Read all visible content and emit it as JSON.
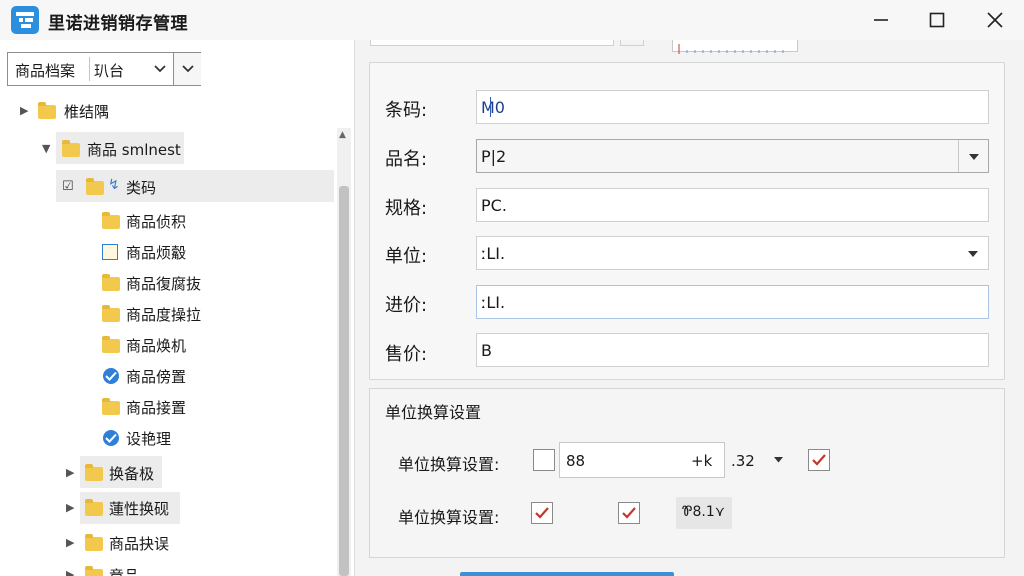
{
  "window": {
    "title": "里诺进销销存管理",
    "colors": {
      "accent": "#2b8fe0",
      "check_red": "#c0392b",
      "check_blue": "#2f7fd6",
      "folder": "#f2c94c"
    }
  },
  "sidebar": {
    "combo": {
      "text1": "商品档案",
      "text2": "玐台"
    },
    "tree": [
      {
        "label": "椎结隅",
        "icon": "folder-icon",
        "expander": "collapsed"
      },
      {
        "label": "商品 smlnest",
        "icon": "folder-icon",
        "expander": "expanded"
      },
      {
        "label": "类码",
        "icon": "folder-icon",
        "expander": "expanded"
      },
      {
        "label": "商品侦积",
        "icon": "folder-icon"
      },
      {
        "label": "商品烦觳",
        "icon": "document-icon"
      },
      {
        "label": "商品復腐抜",
        "icon": "folder-icon"
      },
      {
        "label": "商品度操拉",
        "icon": "folder-icon"
      },
      {
        "label": "商品焕机",
        "icon": "folder-icon"
      },
      {
        "label": "商品傍置",
        "icon": "blue-check-icon"
      },
      {
        "label": "商品接置",
        "icon": "folder-icon"
      },
      {
        "label": "设艳理",
        "icon": "blue-check-icon"
      },
      {
        "label": "换备极",
        "icon": "folder-icon",
        "expander": "collapsed"
      },
      {
        "label": "蓮性换砚",
        "icon": "folder-icon",
        "expander": "collapsed"
      },
      {
        "label": "商品抉误",
        "icon": "folder-icon",
        "expander": "collapsed"
      },
      {
        "label": "竟品",
        "icon": "folder-icon",
        "expander": "collapsed"
      }
    ]
  },
  "form": {
    "barcode": {
      "label": "条码:",
      "value": "M0"
    },
    "name": {
      "label": "品名:",
      "value": "P|2"
    },
    "spec": {
      "label": "规格:",
      "value": "PC."
    },
    "unit": {
      "label": "单位:",
      "value": "ːLI."
    },
    "cost": {
      "label": "进价:",
      "value": "ːLI."
    },
    "price": {
      "label": "售价:",
      "value": "B"
    }
  },
  "conversion": {
    "title": "单位换算设置",
    "row1": {
      "label": "单位换算设置:",
      "value1": "88",
      "value2": "+k",
      "suffix": ".32"
    },
    "row2": {
      "label": "单位换算设置:",
      "field_value": "Ꮘ8.1⋎"
    }
  }
}
